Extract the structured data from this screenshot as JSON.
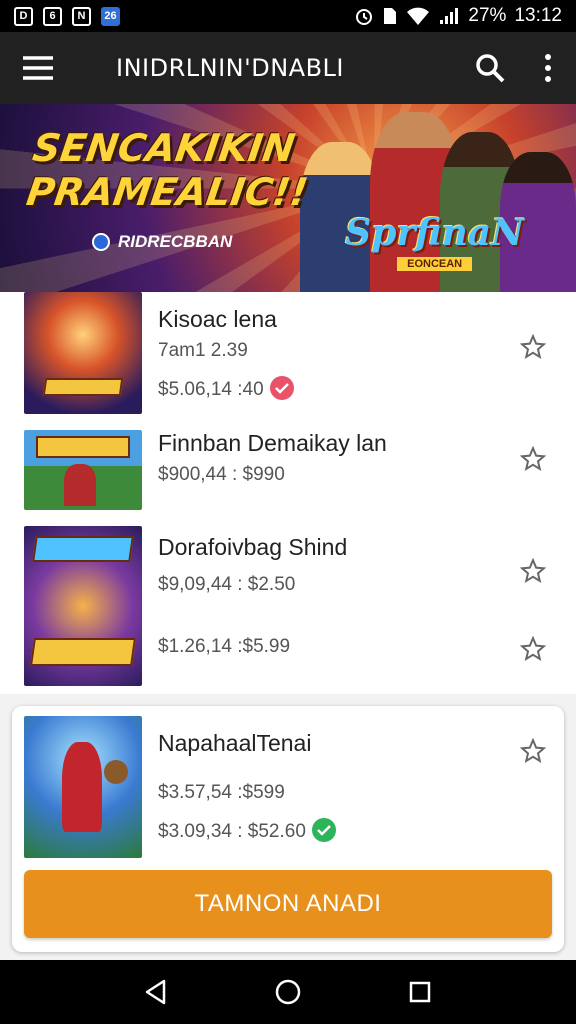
{
  "status_bar": {
    "notifications": [
      "D",
      "6",
      "N",
      "26"
    ],
    "battery": "27%",
    "time": "13:12"
  },
  "app_bar": {
    "title": "INIDRLNIN'DNABLI",
    "icons": {
      "menu": "menu-icon",
      "search": "search-icon",
      "overflow": "more-vert-icon"
    }
  },
  "banner": {
    "headline_line1": "SENCAKIKIN",
    "headline_line2": "PRAMEALIC!!",
    "subtitle": "RIDRECBBAN",
    "logo_main": "SprfinaN",
    "logo_sub": "EONCEAN"
  },
  "list": [
    {
      "title": "Kisoac lena",
      "meta1": "7am1 2.39",
      "meta2": "$5.06,14 :40",
      "badge_color": "#e8536a",
      "star": "star-outline-icon"
    },
    {
      "title": "Finnban Demaikay lan",
      "meta1": "$900,44 : $990",
      "star": "star-outline-icon"
    },
    {
      "title": "Dorafoivbag Shind",
      "meta1": "$9,09,44 : $2.50",
      "meta2": "$1.26,14 :$5.99",
      "star": "star-outline-icon"
    }
  ],
  "card": {
    "title": "NapahaalTenai",
    "meta1": "$3.57,54 :$599",
    "meta2": "$3.09,34 : $52.60",
    "badge_color": "#2db35a",
    "cta_label": "TAMNON ANADI"
  },
  "colors": {
    "app_bar": "#212121",
    "accent": "#e8901c",
    "star": "#666666"
  }
}
